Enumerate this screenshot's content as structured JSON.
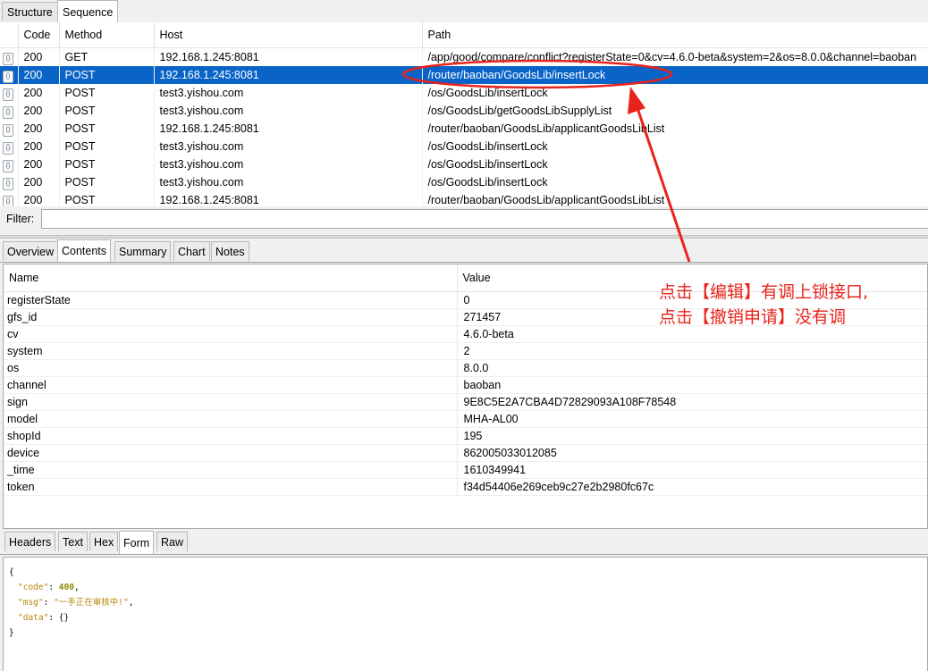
{
  "top_tabs": [
    "Structure",
    "Sequence"
  ],
  "sequence": {
    "columns": [
      "Code",
      "Method",
      "Host",
      "Path"
    ],
    "rows": [
      {
        "code": "200",
        "method": "GET",
        "host": "192.168.1.245:8081",
        "path": "/app/good/compare/conflict?registerState=0&cv=4.6.0-beta&system=2&os=8.0.0&channel=baoban"
      },
      {
        "code": "200",
        "method": "POST",
        "host": "192.168.1.245:8081",
        "path": "/router/baoban/GoodsLib/insertLock",
        "selected": true
      },
      {
        "code": "200",
        "method": "POST",
        "host": "test3.yishou.com",
        "path": "/os/GoodsLib/insertLock"
      },
      {
        "code": "200",
        "method": "POST",
        "host": "test3.yishou.com",
        "path": "/os/GoodsLib/getGoodsLibSupplyList"
      },
      {
        "code": "200",
        "method": "POST",
        "host": "192.168.1.245:8081",
        "path": "/router/baoban/GoodsLib/applicantGoodsLibList"
      },
      {
        "code": "200",
        "method": "POST",
        "host": "test3.yishou.com",
        "path": "/os/GoodsLib/insertLock"
      },
      {
        "code": "200",
        "method": "POST",
        "host": "test3.yishou.com",
        "path": "/os/GoodsLib/insertLock"
      },
      {
        "code": "200",
        "method": "POST",
        "host": "test3.yishou.com",
        "path": "/os/GoodsLib/insertLock"
      },
      {
        "code": "200",
        "method": "POST",
        "host": "192.168.1.245:8081",
        "path": "/router/baoban/GoodsLib/applicantGoodsLibList"
      }
    ]
  },
  "filter": {
    "label": "Filter:",
    "value": ""
  },
  "inspector_tabs": [
    "Overview",
    "Contents",
    "Summary",
    "Chart",
    "Notes"
  ],
  "form": {
    "columns": [
      "Name",
      "Value"
    ],
    "rows": [
      {
        "name": "registerState",
        "value": "0"
      },
      {
        "name": "gfs_id",
        "value": "271457"
      },
      {
        "name": "cv",
        "value": "4.6.0-beta"
      },
      {
        "name": "system",
        "value": "2"
      },
      {
        "name": "os",
        "value": "8.0.0"
      },
      {
        "name": "channel",
        "value": "baoban"
      },
      {
        "name": "sign",
        "value": "9E8C5E2A7CBA4D72829093A108F78548"
      },
      {
        "name": "model",
        "value": "MHA-AL00"
      },
      {
        "name": "shopId",
        "value": "195"
      },
      {
        "name": "device",
        "value": "862005033012085"
      },
      {
        "name": "_time",
        "value": "1610349941"
      },
      {
        "name": "token",
        "value": "f34d54406e269ceb9c27e2b2980fc67c"
      }
    ]
  },
  "body_tabs": [
    "Headers",
    "Text",
    "Hex",
    "Form",
    "Raw"
  ],
  "response": {
    "open": "{",
    "code_key": "\"code\"",
    "code_val": "400",
    "msg_key": "\"msg\"",
    "msg_val": "\"一手正在审核中!\"",
    "data_key": "\"data\"",
    "data_val": "{}",
    "close": "}"
  },
  "annotation": {
    "line1": "点击【编辑】有调上锁接口,",
    "line2": "点击【撤销申请】没有调",
    "color": "#e8231b"
  }
}
